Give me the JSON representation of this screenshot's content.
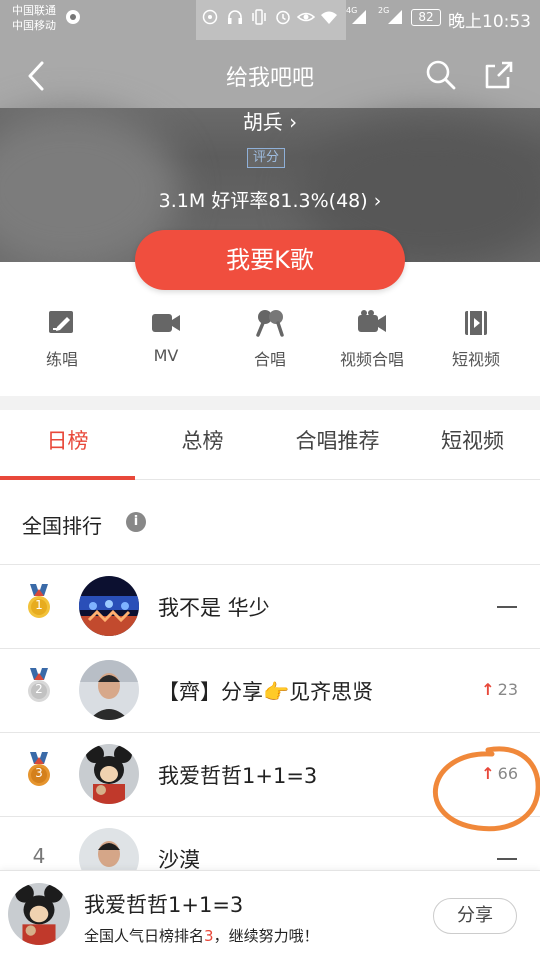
{
  "status_bar": {
    "carrier1": "中国联通",
    "carrier2": "中国移动",
    "net4g": "4G",
    "net2g": "2G",
    "battery": "82",
    "time": "晚上10:53"
  },
  "nav": {
    "title": "给我吧吧"
  },
  "song": {
    "singer": "胡兵 ›",
    "rating_tag": "评分",
    "stats": "3.1M  好评率81.3%(48) ›",
    "ksong_label": "我要K歌"
  },
  "functions": [
    {
      "label": "练唱",
      "icon": "practice-icon"
    },
    {
      "label": "MV",
      "icon": "video-camera-icon"
    },
    {
      "label": "合唱",
      "icon": "duet-microphone-icon"
    },
    {
      "label": "视频合唱",
      "icon": "video-duet-icon"
    },
    {
      "label": "短视频",
      "icon": "short-video-icon"
    }
  ],
  "tabs": [
    {
      "label": "日榜",
      "active": true
    },
    {
      "label": "总榜",
      "active": false
    },
    {
      "label": "合唱推荐",
      "active": false
    },
    {
      "label": "短视频",
      "active": false
    }
  ],
  "section": {
    "title": "全国排行",
    "info_icon": "i"
  },
  "rankings": [
    {
      "rank": "1",
      "name": "我不是 华少",
      "trend": "—",
      "medal": "gold"
    },
    {
      "rank": "2",
      "name": "【齊】分享👉见齐思贤",
      "trend": "23",
      "trend_dir": "up",
      "medal": "silver"
    },
    {
      "rank": "3",
      "name": "我爱哲哲1+1=3",
      "trend": "66",
      "trend_dir": "up",
      "medal": "bronze"
    },
    {
      "rank": "4",
      "name": "沙漠",
      "trend": "—"
    }
  ],
  "bottom_bar": {
    "name": "我爱哲哲1+1=3",
    "msg_prefix": "全国人气日榜排名",
    "msg_rank": "3",
    "msg_suffix": "，继续努力哦！",
    "share_label": "分享"
  },
  "colors": {
    "accent": "#e8483a",
    "button": "#f04e3e",
    "annotation": "#f0883a"
  }
}
